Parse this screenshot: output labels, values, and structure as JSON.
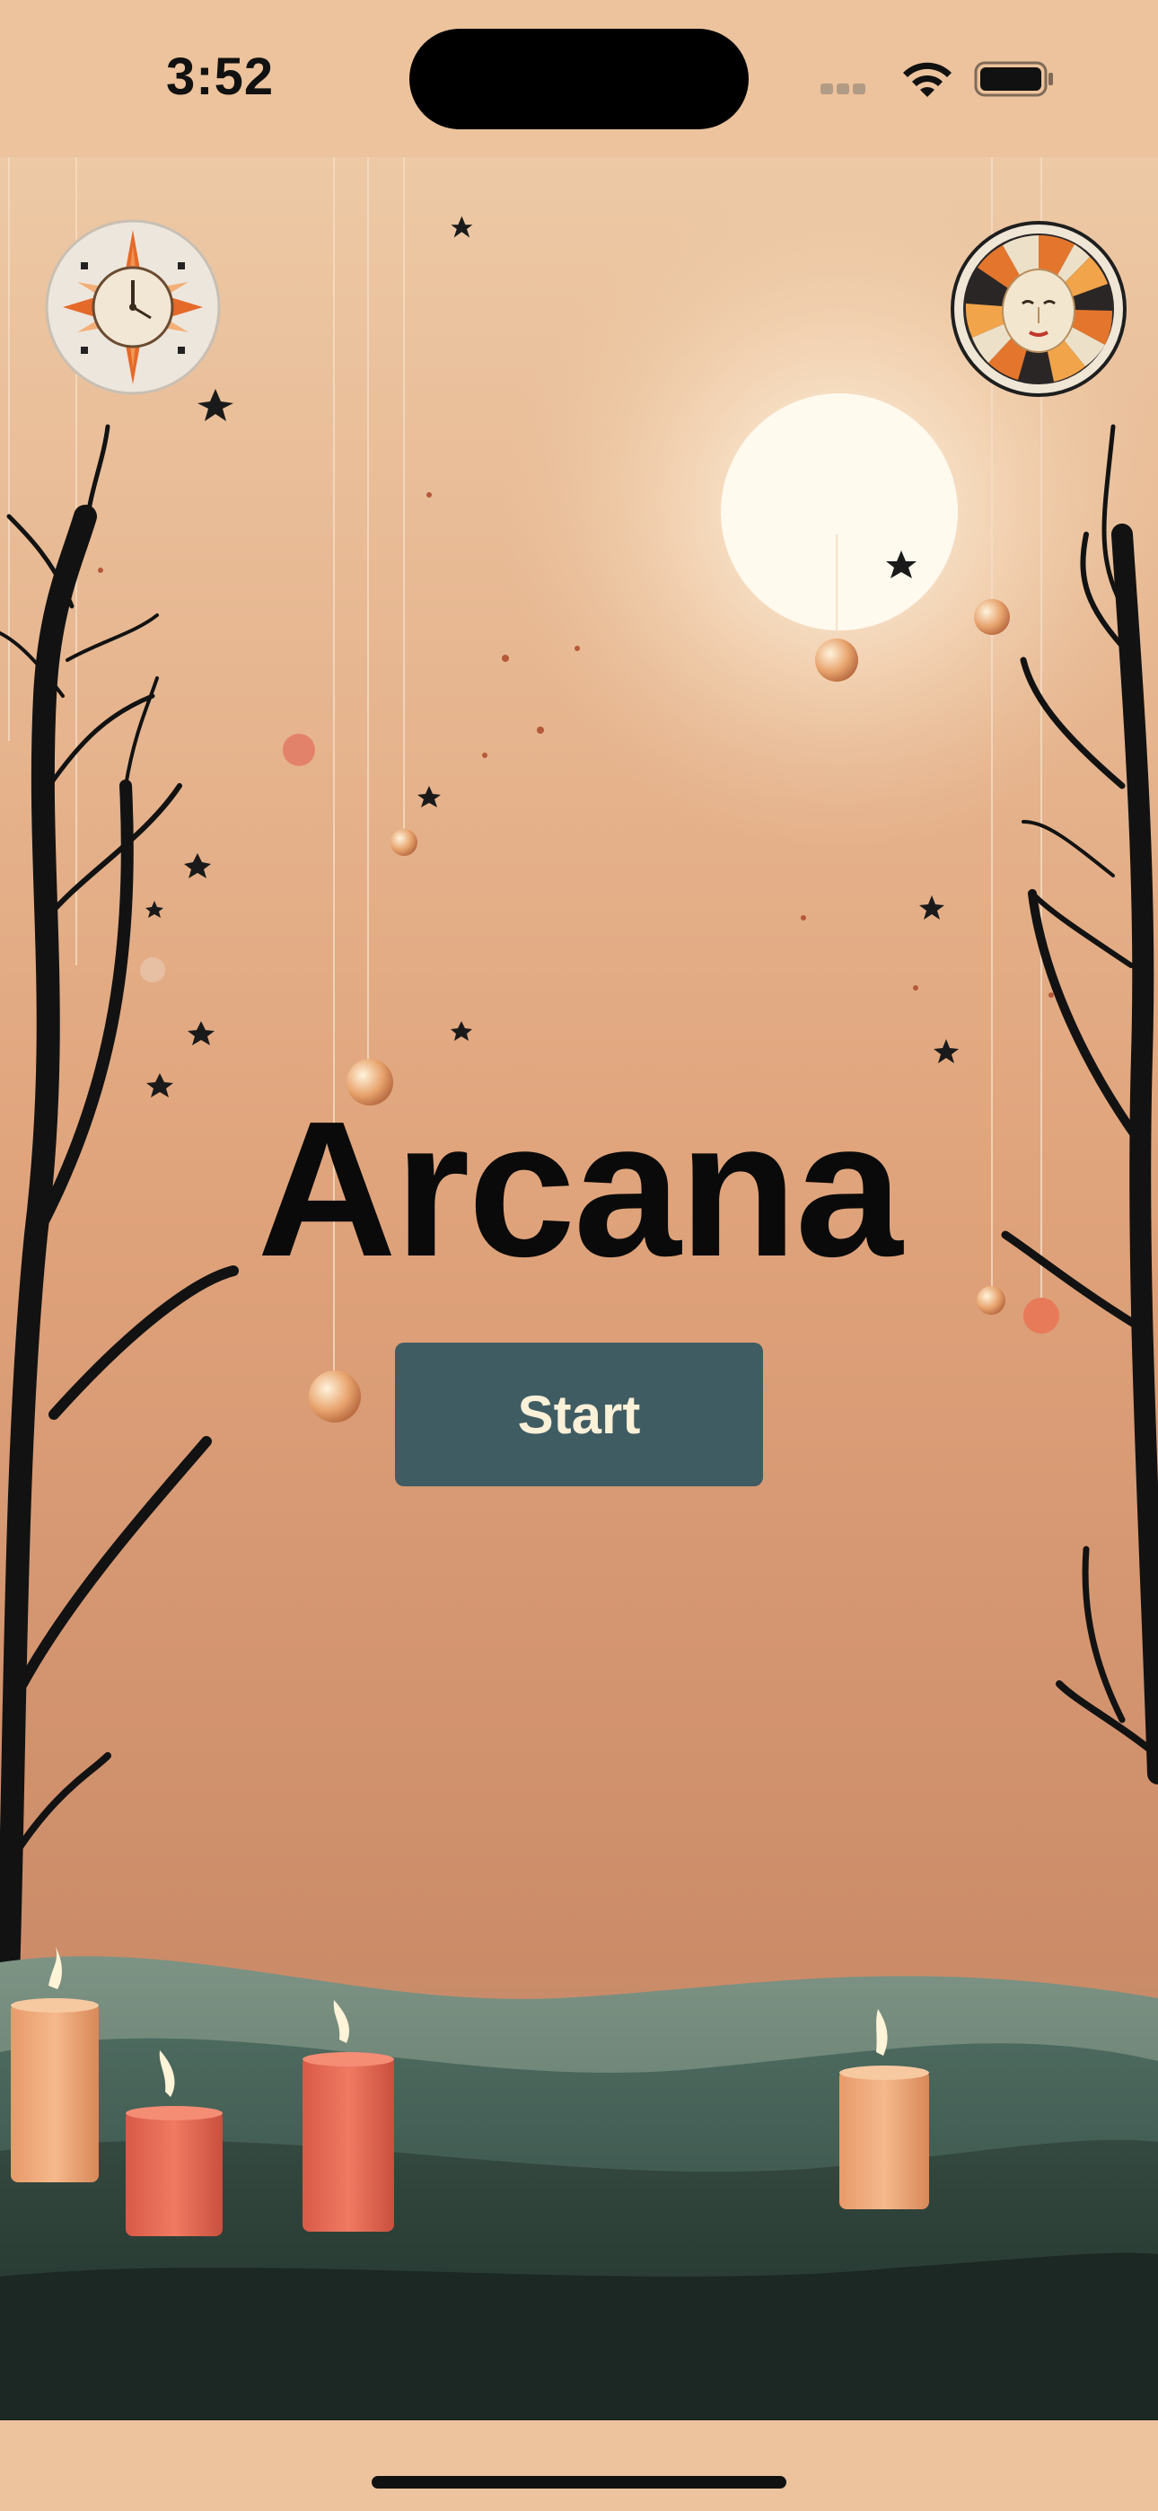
{
  "status_bar": {
    "time": "3:52"
  },
  "icons": {
    "left_button": "compass-clock-icon",
    "right_button": "sun-face-icon",
    "wifi": "wifi-icon",
    "battery": "battery-icon",
    "signal": "cellular-signal-icon"
  },
  "main": {
    "title": "Arcana",
    "start_label": "Start"
  },
  "colors": {
    "background": "#ecc39d",
    "button": "#405c63",
    "button_text": "#fbf0d8",
    "title": "#0a0a0a"
  }
}
